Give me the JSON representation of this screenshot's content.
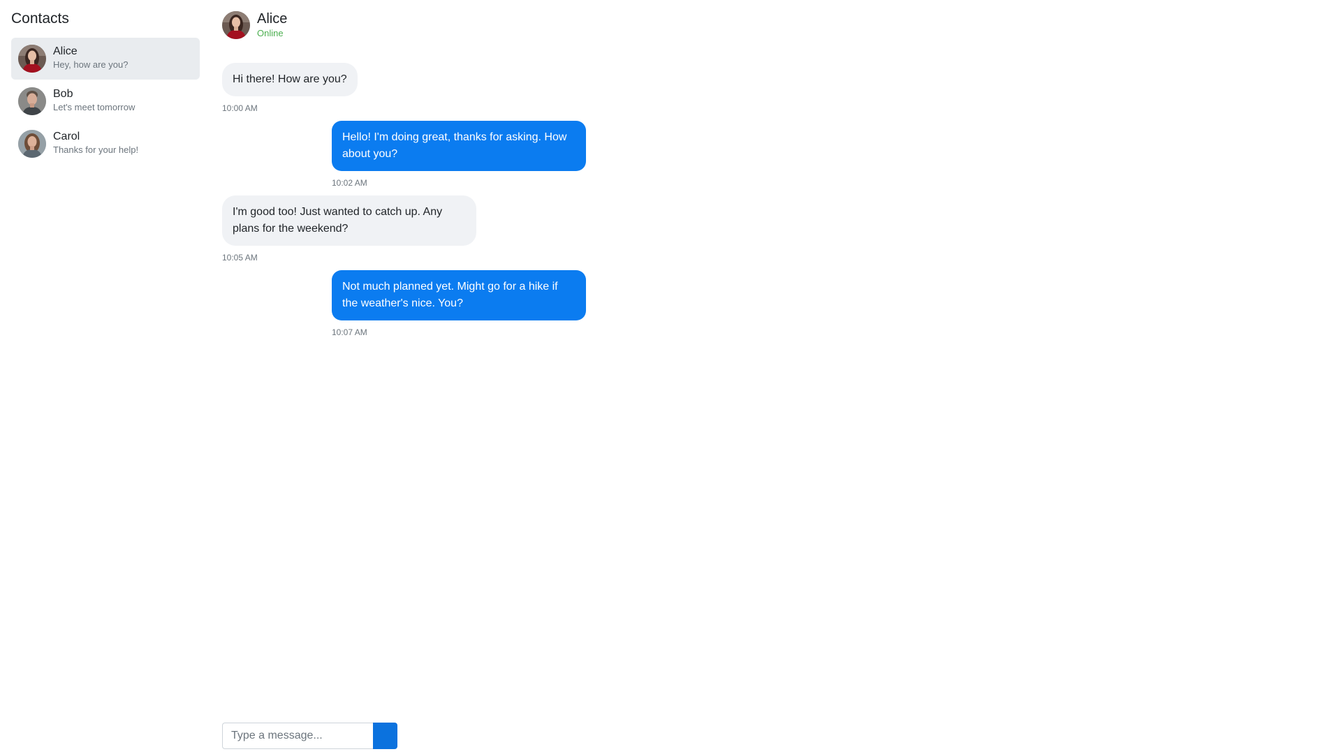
{
  "sidebar": {
    "title": "Contacts",
    "contacts": [
      {
        "name": "Alice",
        "preview": "Hey, how are you?",
        "active": true
      },
      {
        "name": "Bob",
        "preview": "Let's meet tomorrow",
        "active": false
      },
      {
        "name": "Carol",
        "preview": "Thanks for your help!",
        "active": false
      }
    ]
  },
  "chat": {
    "name": "Alice",
    "status": "Online",
    "messages": [
      {
        "direction": "incoming",
        "text": "Hi there! How are you?",
        "time": "10:00 AM"
      },
      {
        "direction": "outgoing",
        "text": "Hello! I'm doing great, thanks for asking. How about you?",
        "time": "10:02 AM"
      },
      {
        "direction": "incoming",
        "text": "I'm good too! Just wanted to catch up. Any plans for the weekend?",
        "time": "10:05 AM"
      },
      {
        "direction": "outgoing",
        "text": "Not much planned yet. Might go for a hike if the weather's nice. You?",
        "time": "10:07 AM"
      }
    ]
  },
  "composer": {
    "placeholder": "Type a message...",
    "value": ""
  },
  "colors": {
    "accent": "#0b7cf0",
    "online": "#4caf50",
    "active_contact_bg": "#e9ecef",
    "incoming_bubble": "#f0f2f5"
  },
  "icons": {
    "send": "send-icon"
  }
}
